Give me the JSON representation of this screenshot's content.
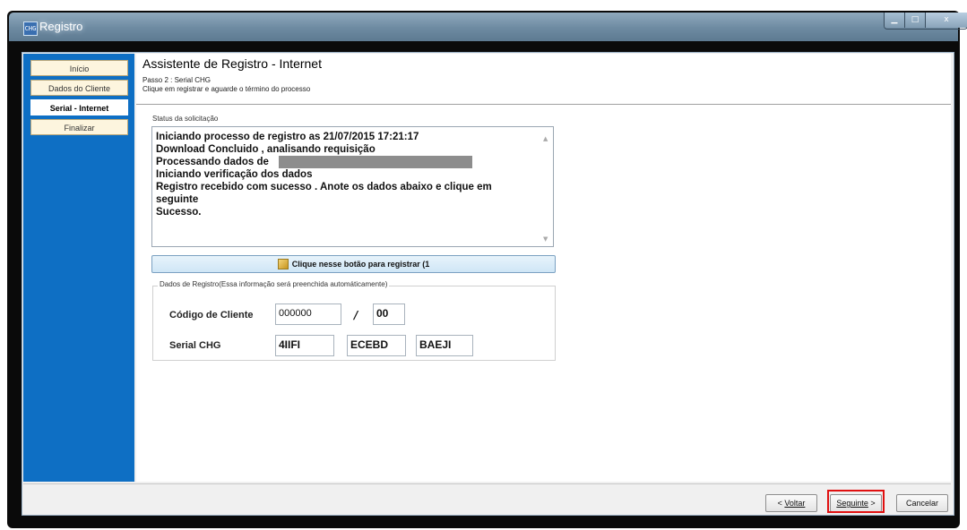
{
  "window": {
    "title": "Registro",
    "icon_text": "CHG",
    "controls": [
      "minimize-icon",
      "maximize-icon",
      "close-icon"
    ],
    "min_glyph": "▁",
    "max_glyph": "□",
    "close_glyph": "x"
  },
  "sidebar": {
    "items": [
      {
        "label": "Início"
      },
      {
        "label": "Dados do Cliente"
      },
      {
        "label": "Serial - Internet",
        "active": true
      },
      {
        "label": "Finalizar"
      }
    ]
  },
  "header": {
    "title": "Assistente de Registro - Internet",
    "step": "Passo 2 : Serial CHG",
    "instruction": "Clique em registrar e aguarde o término do processo"
  },
  "status": {
    "label": "Status da solicitação",
    "lines": [
      "Iniciando processo de registro as 21/07/2015 17:21:17",
      "Download Concluido , analisando requisição",
      "Processando dados de",
      "Iniciando verificação dos dados",
      "Registro recebido com sucesso . Anote os dados abaixo e clique em",
      "seguinte",
      "Sucesso."
    ]
  },
  "register_button": {
    "label": "Clique nesse botão para registrar (1",
    "icon": "pencil-icon"
  },
  "registration_data": {
    "legend": "Dados de Registro(Essa informação será preenchida automáticamente)",
    "client_code_label": "Código de Cliente",
    "client_code": "000000",
    "client_code_suffix": "00",
    "separator": "/",
    "serial_label": "Serial CHG",
    "serial_parts": [
      "4IIFI",
      "ECEBD",
      "BAEJI"
    ]
  },
  "footer": {
    "back_prefix": "< ",
    "back": "Voltar",
    "next": "Seguinte",
    "next_suffix": " >",
    "cancel": "Cancelar"
  },
  "colors": {
    "sidebar": "#0e6fc4",
    "highlight": "#e01010",
    "step_bg": "#fdf5de"
  }
}
